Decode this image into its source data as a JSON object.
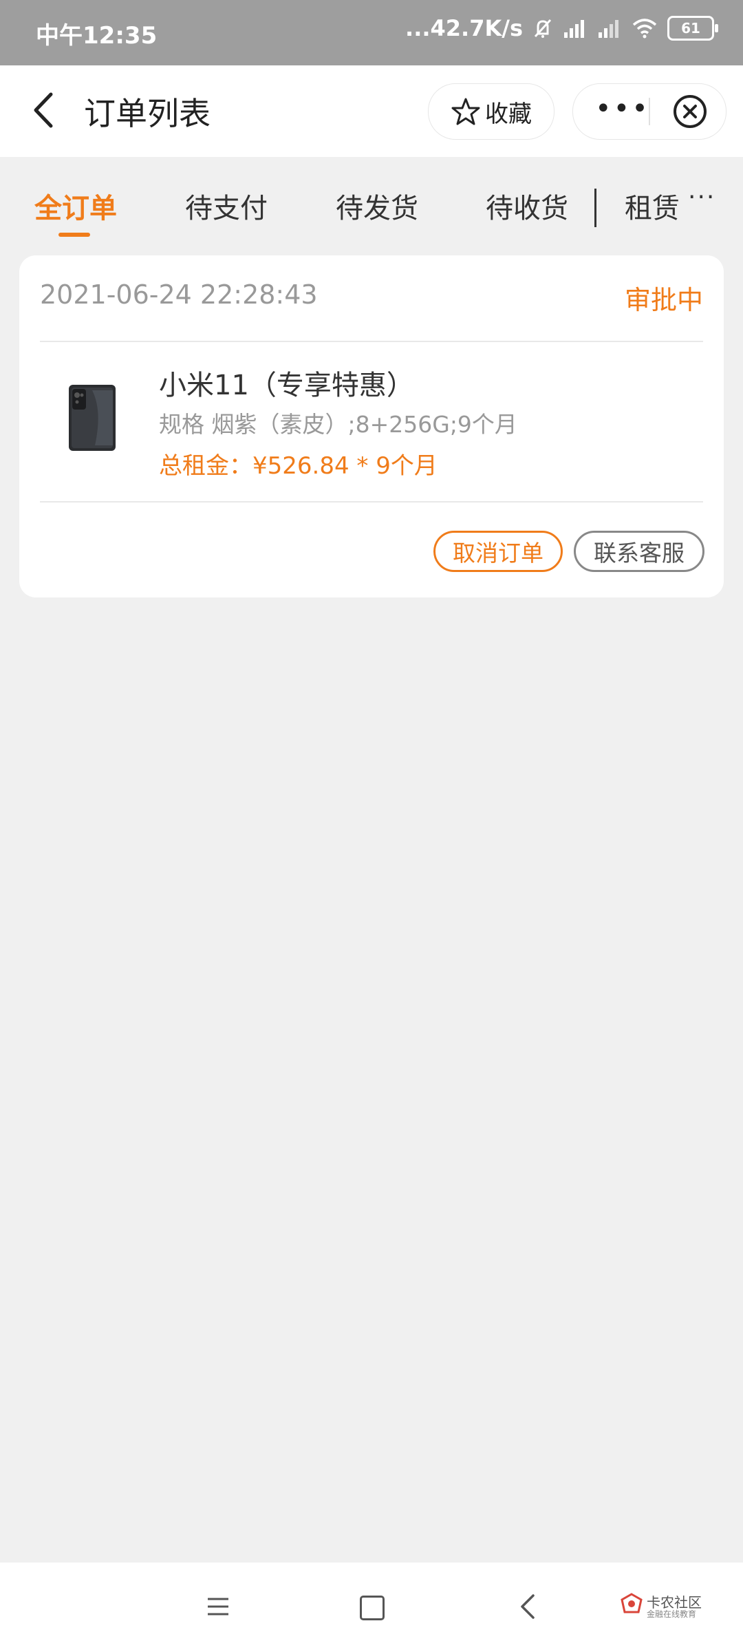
{
  "status_bar": {
    "time": "中午12:35",
    "net_speed": "...42.7K/s",
    "battery": "61"
  },
  "header": {
    "title": "订单列表",
    "favorite_label": "收藏"
  },
  "tabs": [
    {
      "label": "全订单",
      "active": true
    },
    {
      "label": "待支付",
      "active": false
    },
    {
      "label": "待发货",
      "active": false
    },
    {
      "label": "待收货",
      "active": false
    },
    {
      "label": "租赁",
      "active": false
    }
  ],
  "tab_more": "···",
  "order": {
    "date": "2021-06-24 22:28:43",
    "status": "审批中",
    "product_name": "小米11（专享特惠）",
    "spec": "规格 烟紫（素皮）;8+256G;9个月",
    "total": "总租金：¥526.84 * 9个月",
    "cancel_label": "取消订单",
    "service_label": "联系客服"
  },
  "watermark": {
    "line1": "卡农社区",
    "line2": "金融在线教育"
  },
  "colors": {
    "accent": "#f07c1a",
    "status_bar": "#9e9e9e",
    "background": "#f0f0f0"
  }
}
